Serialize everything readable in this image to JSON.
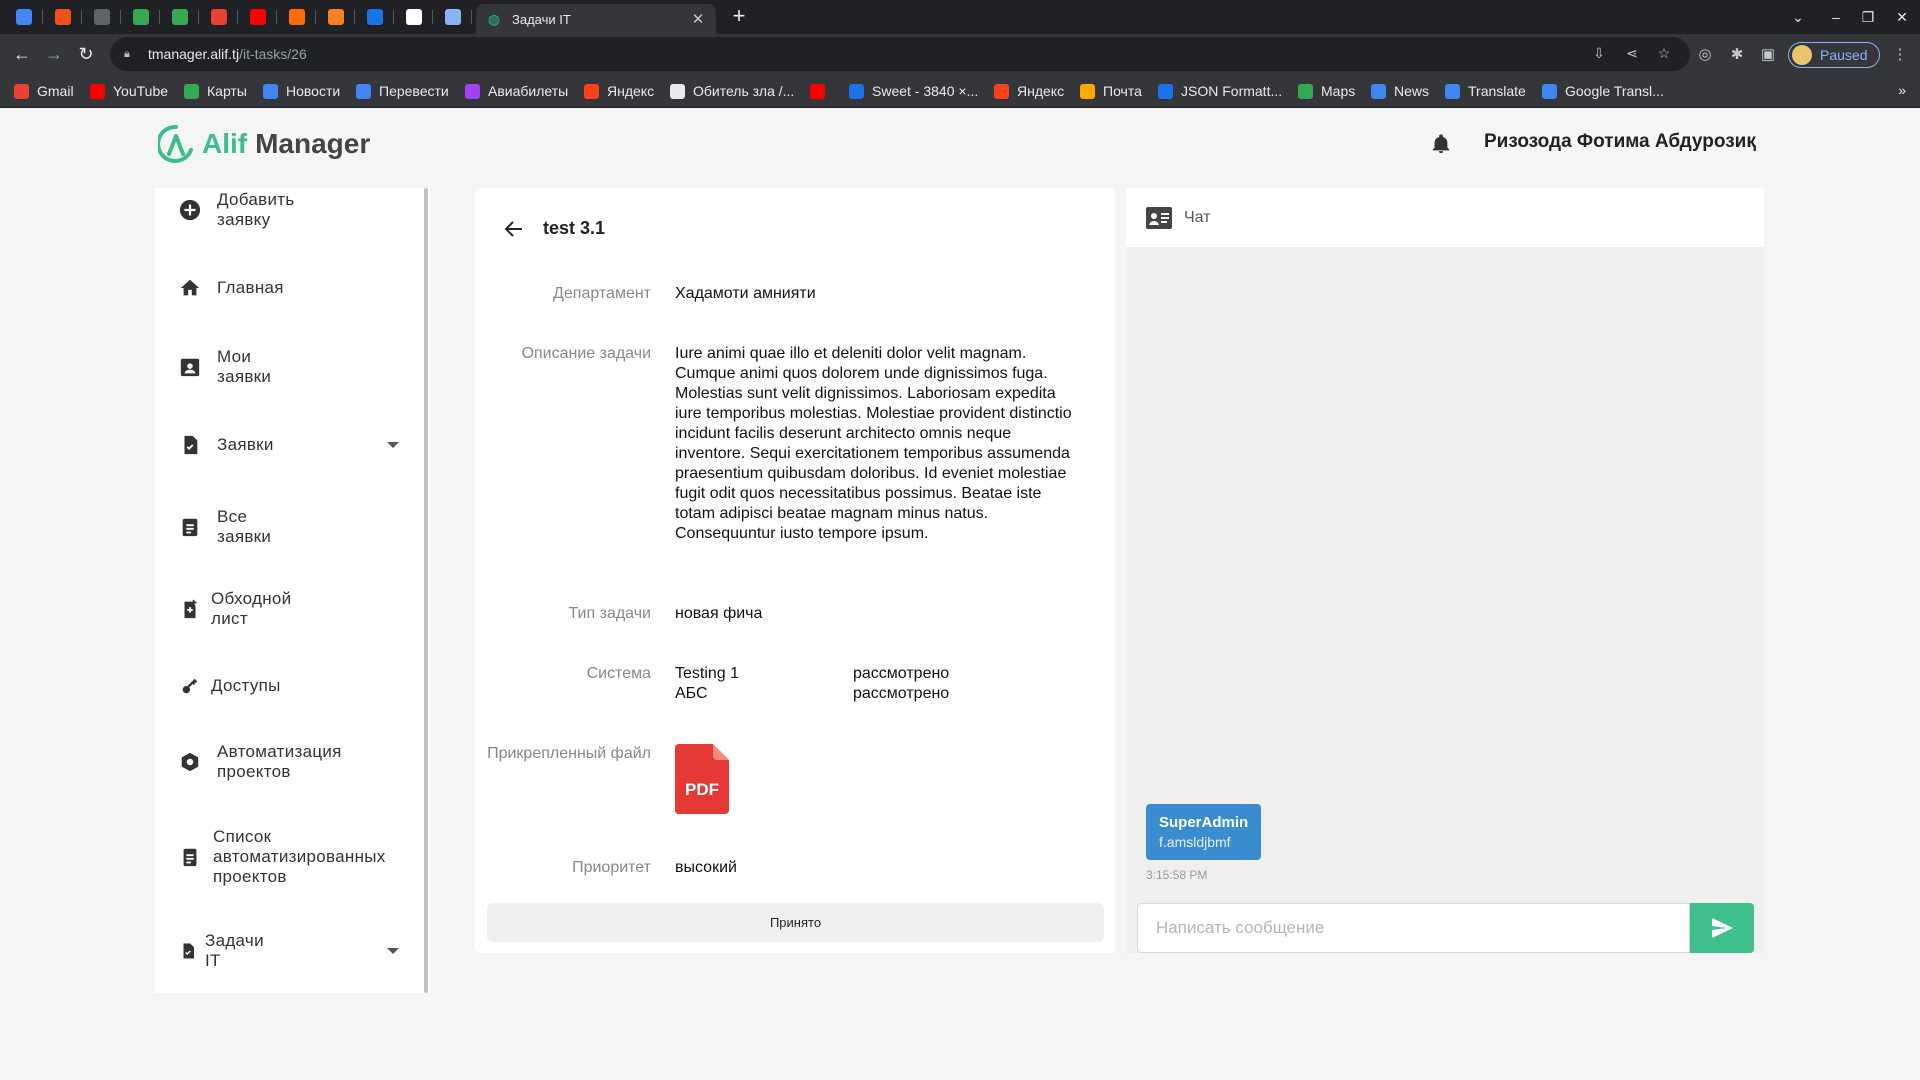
{
  "browser": {
    "pinned_tabs": [
      {
        "icon": "docs-icon",
        "color": "#4285f4"
      },
      {
        "icon": "figma-icon",
        "color": "#f24e1e"
      },
      {
        "icon": "globe-icon",
        "color": "#5f6368"
      },
      {
        "icon": "green-app-icon",
        "color": "#34a853"
      },
      {
        "icon": "green-app-icon",
        "color": "#34a853"
      },
      {
        "icon": "color-wheel-icon",
        "color": "#e94235"
      },
      {
        "icon": "youtube-icon",
        "color": "#ff0000"
      },
      {
        "icon": "orange-app-icon",
        "color": "#ff6d00"
      },
      {
        "icon": "cloud-icon",
        "color": "#f6821f"
      },
      {
        "icon": "cube-icon",
        "color": "#1a73e8"
      },
      {
        "icon": "google-icon",
        "color": "#ffffff"
      },
      {
        "icon": "mail-icon",
        "color": "#8ab4f8"
      }
    ],
    "active_tab_title": "Задачи IT",
    "url_host": "tmanager.alif.tj",
    "url_path": "/it-tasks/26",
    "profile_label": "Paused",
    "bookmarks": [
      {
        "label": "Gmail",
        "icon": "gmail-icon",
        "color": "#ea4335"
      },
      {
        "label": "YouTube",
        "icon": "youtube-icon",
        "color": "#ff0000"
      },
      {
        "label": "Карты",
        "icon": "maps-pin-icon",
        "color": "#34a853"
      },
      {
        "label": "Новости",
        "icon": "google-icon",
        "color": "#4285f4"
      },
      {
        "label": "Перевести",
        "icon": "translate-icon",
        "color": "#4285f4"
      },
      {
        "label": "Авиабилеты",
        "icon": "plane-icon",
        "color": "#a142f4"
      },
      {
        "label": "Яндекс",
        "icon": "yandex-icon",
        "color": "#fc3f1d"
      },
      {
        "label": "Обитель зла /...",
        "icon": "site-icon",
        "color": "#e8eaed"
      },
      {
        "label": "",
        "icon": "youtube-icon",
        "color": "#ff0000"
      },
      {
        "label": "Sweet - 3840 ×...",
        "icon": "sweet-icon",
        "color": "#1a73e8"
      },
      {
        "label": "Яндекс",
        "icon": "yandex-icon",
        "color": "#fc3f1d"
      },
      {
        "label": "Почта",
        "icon": "mail-icon",
        "color": "#f9ab00"
      },
      {
        "label": "JSON Formatt...",
        "icon": "check-icon",
        "color": "#1a73e8"
      },
      {
        "label": "Maps",
        "icon": "maps-pin-icon",
        "color": "#34a853"
      },
      {
        "label": "News",
        "icon": "google-icon",
        "color": "#4285f4"
      },
      {
        "label": "Translate",
        "icon": "translate-icon",
        "color": "#4285f4"
      },
      {
        "label": "Google Transl...",
        "icon": "translate-icon",
        "color": "#4285f4"
      }
    ],
    "bookmarks_more": "»"
  },
  "app": {
    "logo_brand": "Alif",
    "logo_product": "Manager",
    "accent_color": "#3dbd8c",
    "user_name": "Ризозода Фотима Абдурозиқ"
  },
  "sidebar": {
    "items": [
      {
        "label": "Добавить заявку",
        "icon": "add-circle-icon",
        "has_arrow": false
      },
      {
        "label": "Главная",
        "icon": "home-icon",
        "has_arrow": false
      },
      {
        "label": "Мои заявки",
        "icon": "contact-card-icon",
        "has_arrow": false
      },
      {
        "label": "Заявки",
        "icon": "document-icon",
        "has_arrow": true
      },
      {
        "label": "Все заявки",
        "icon": "clipboard-icon",
        "has_arrow": false
      },
      {
        "label": "Обходной лист",
        "icon": "document-add-icon",
        "has_arrow": false
      },
      {
        "label": "Доступы",
        "icon": "key-icon",
        "has_arrow": false
      },
      {
        "label": "Автоматизация проектов",
        "icon": "hexagon-gear-icon",
        "has_arrow": false
      },
      {
        "label": "Список автоматизированных проектов",
        "icon": "clipboard-list-icon",
        "has_arrow": false
      },
      {
        "label": "Задачи IT",
        "icon": "document-icon",
        "has_arrow": true
      }
    ]
  },
  "task": {
    "title": "test 3.1",
    "department_label": "Департамент",
    "department_value": "Хадамоти амнияти",
    "description_label": "Описание задачи",
    "description_value": "Iure animi quae illo et deleniti dolor velit magnam. Cumque animi quos dolorem unde dignissimos fuga. Molestias sunt velit dignissimos. Laboriosam expedita iure temporibus molestias. Molestiae provident distinctio incidunt facilis deserunt architecto omnis neque inventore. Sequi exercitationem temporibus assumenda praesentium quibusdam doloribus. Id eveniet molestiae fugit odit quos necessitatibus possimus. Beatae iste totam adipisci beatae magnam minus natus. Consequuntur iusto tempore ipsum.",
    "type_label": "Тип задачи",
    "type_value": "новая фича",
    "system_label": "Система",
    "systems": [
      {
        "name": "Testing 1",
        "status": "рассмотрено"
      },
      {
        "name": "АБС",
        "status": "рассмотрено"
      }
    ],
    "attachment_label": "Прикрепленный файл",
    "attachment_type": "PDF",
    "attachment_color": "#e53935",
    "priority_label": "Приоритет",
    "priority_value": "высокий",
    "status_button": "Принято"
  },
  "chat": {
    "title": "Чат",
    "messages": [
      {
        "author": "SuperAdmin",
        "text": "f.amsldjbmf",
        "time": "3:15:58 PM"
      }
    ],
    "input_placeholder": "Написать сообщение",
    "send_color": "#3fc08a"
  }
}
